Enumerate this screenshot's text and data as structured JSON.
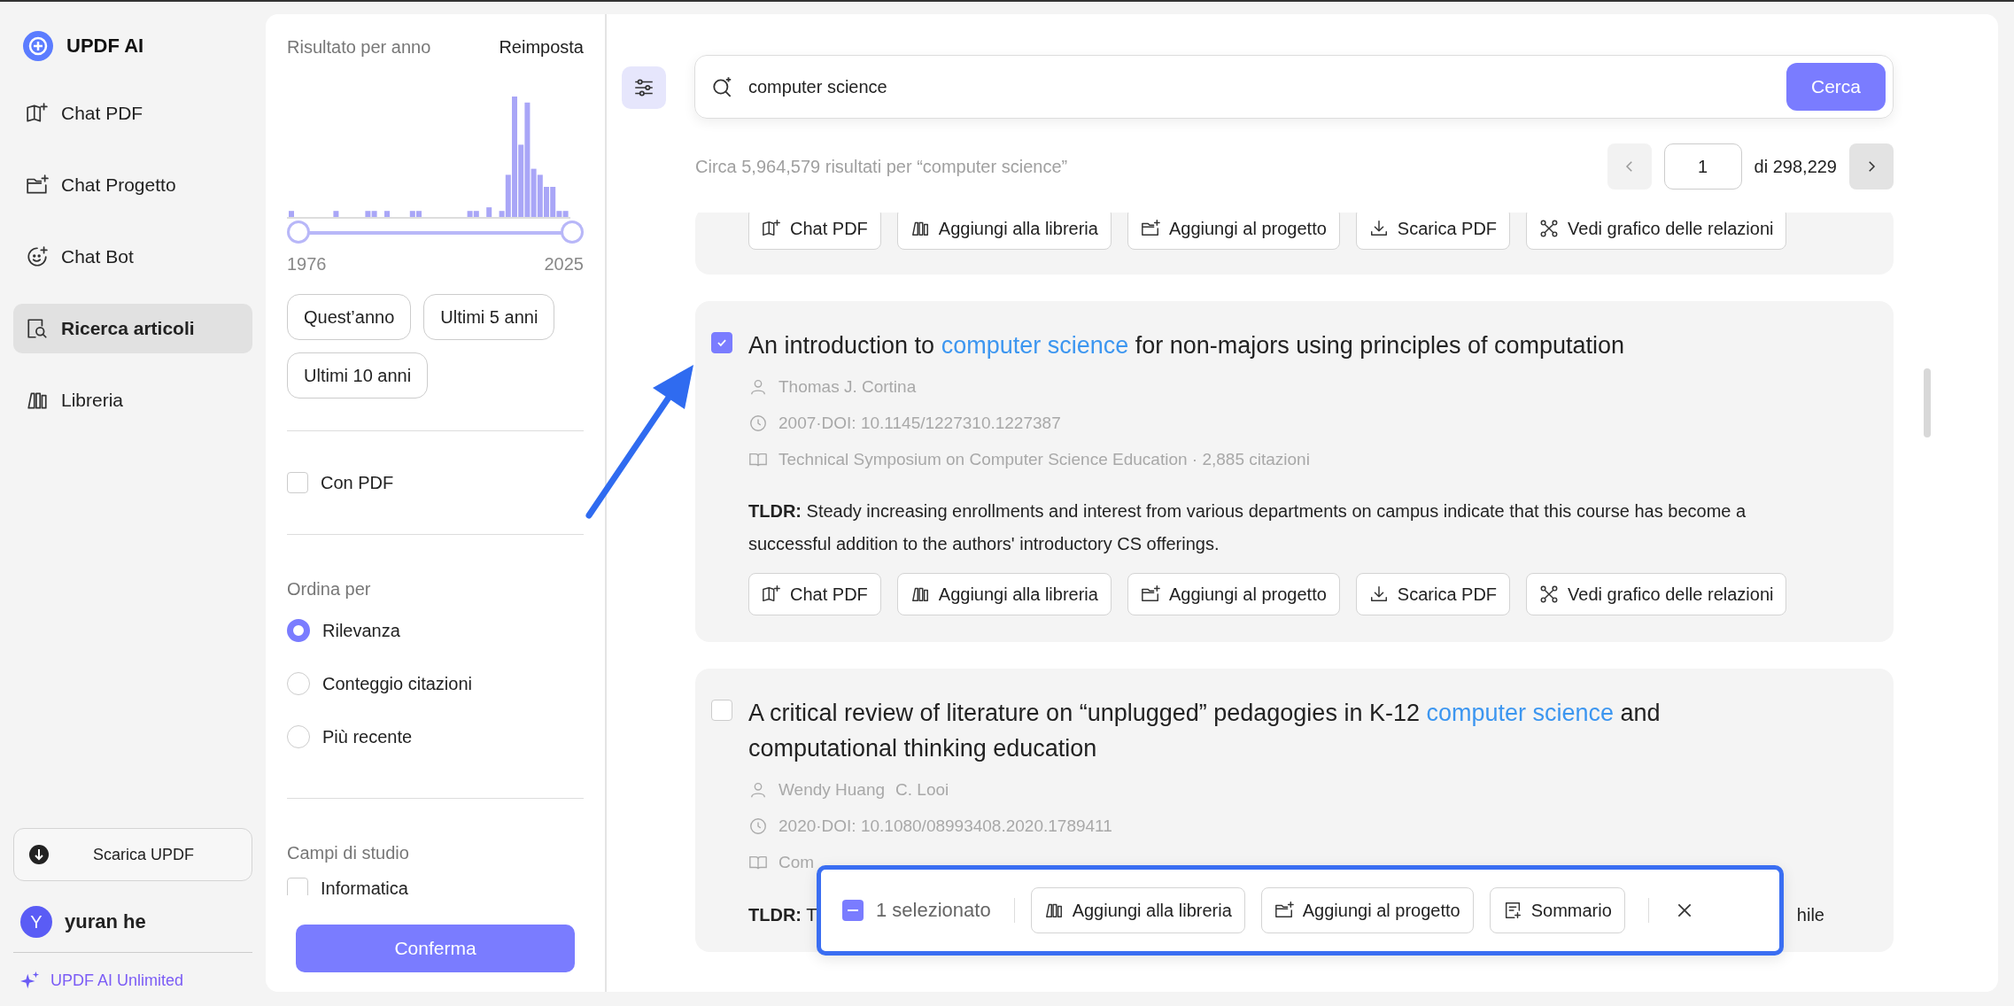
{
  "app": {
    "name": "UPDF AI"
  },
  "nav": [
    {
      "label": "Chat PDF",
      "kind": "chat",
      "selected": false
    },
    {
      "label": "Chat Progetto",
      "kind": "project",
      "selected": false
    },
    {
      "label": "Chat Bot",
      "kind": "bot",
      "selected": false
    },
    {
      "label": "Ricerca articoli",
      "kind": "search",
      "selected": true
    },
    {
      "label": "Libreria",
      "kind": "library",
      "selected": false
    }
  ],
  "download_button": "Scarica UPDF",
  "user": {
    "initial": "Y",
    "name": "yuran he"
  },
  "plan": "UPDF AI Unlimited",
  "filters": {
    "year_title": "Risultato per anno",
    "reset": "Reimposta",
    "year_from": "1976",
    "year_to": "2025",
    "year_range": {
      "level": 1
    },
    "presets": [
      "Quest’anno",
      "Ultimi 5 anni",
      "Ultimi 10 anni"
    ],
    "with_pdf": {
      "label": "Con PDF",
      "checked": false
    },
    "sort_title": "Ordina per",
    "sort_options": [
      {
        "label": "Rilevanza",
        "selected": true
      },
      {
        "label": "Conteggio citazioni",
        "selected": false
      },
      {
        "label": "Più recente",
        "selected": false
      }
    ],
    "fields_title": "Campi di studio",
    "fields": [
      {
        "label": "Informatica",
        "checked": false
      }
    ],
    "confirm": "Conferma"
  },
  "search": {
    "value": "computer science",
    "button": "Cerca"
  },
  "results_summary": "Circa 5,964,579 risultati per “computer science”",
  "pagination": {
    "page": "1",
    "total": "di 298,229"
  },
  "results": [
    {
      "actions": [
        {
          "label": "Chat PDF",
          "kind": "chat"
        },
        {
          "label": "Aggiungi alla libreria",
          "kind": "library"
        },
        {
          "label": "Aggiungi al progetto",
          "kind": "project"
        },
        {
          "label": "Scarica PDF",
          "kind": "download"
        },
        {
          "label": "Vedi grafico delle relazioni",
          "kind": "graph"
        }
      ]
    },
    {
      "selected": true,
      "title_parts": [
        {
          "text": "An introduction to ",
          "highlight": false
        },
        {
          "text": "computer science",
          "highlight": true
        },
        {
          "text": " for non-majors using principles of computation",
          "highlight": false
        }
      ],
      "authors": [
        "Thomas J. Cortina"
      ],
      "date": "2007·DOI: 10.1145/1227310.1227387",
      "venue": "Technical Symposium on Computer Science Education · 2,885 citazioni",
      "tldr": "**TLDR:** Steady increasing enrollments and interest from various departments on campus indicate that this course has become a successful addition to the authors' introductory CS offerings.",
      "actions": [
        {
          "label": "Chat PDF",
          "kind": "chat"
        },
        {
          "label": "Aggiungi alla libreria",
          "kind": "library"
        },
        {
          "label": "Aggiungi al progetto",
          "kind": "project"
        },
        {
          "label": "Scarica PDF",
          "kind": "download"
        },
        {
          "label": "Vedi grafico delle relazioni",
          "kind": "graph"
        }
      ]
    },
    {
      "selected": false,
      "title_parts": [
        {
          "text": "A critical review of literature on “unplugged” pedagogies in K-12 ",
          "highlight": false
        },
        {
          "text": "computer science",
          "highlight": true
        },
        {
          "text": " and computational thinking education",
          "highlight": false
        }
      ],
      "authors": [
        "Wendy Huang",
        "C. Looi"
      ],
      "date": "2020·DOI: 10.1080/08993408.2020.1789411",
      "venue": "Com",
      "tldr_fragments": [
        "**TLDR:** T",
        "hile"
      ]
    }
  ],
  "selection_bar": {
    "indeterminate": true,
    "count": "1 selezionato",
    "actions": [
      {
        "label": "Aggiungi alla libreria",
        "kind": "library"
      },
      {
        "label": "Aggiungi al progetto",
        "kind": "project"
      },
      {
        "label": "Sommario",
        "kind": "summary"
      }
    ]
  }
}
